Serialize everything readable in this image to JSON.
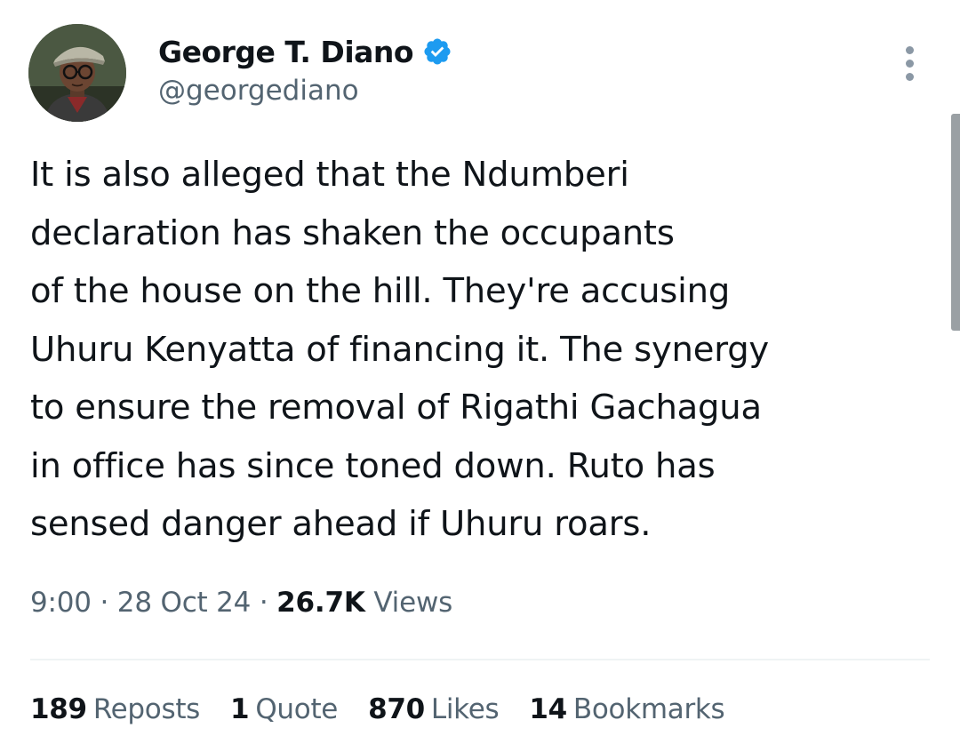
{
  "author": {
    "display_name": "George T. Diano",
    "handle": "@georgediano",
    "avatar_icon": "avatar-illustrated-cap-glasses",
    "verified": true,
    "verified_color": "#1d9bf0"
  },
  "tweet": {
    "lines": [
      "It is also alleged that the Ndumberi",
      "declaration has shaken the occupants",
      "of the house on the hill. They're accusing",
      "Uhuru Kenyatta of financing it. The synergy",
      "to ensure the removal of Rigathi Gachagua",
      "in office has since toned down. Ruto has",
      "sensed danger ahead if Uhuru roars."
    ]
  },
  "meta": {
    "time": "9:00",
    "separator": "·",
    "date": "28 Oct 24",
    "views_count": "26.7K",
    "views_label": "Views"
  },
  "stats": {
    "reposts": {
      "count": "189",
      "label": "Reposts"
    },
    "quotes": {
      "count": "1",
      "label": "Quote"
    },
    "likes": {
      "count": "870",
      "label": "Likes"
    },
    "bookmarks": {
      "count": "14",
      "label": "Bookmarks"
    }
  },
  "colors": {
    "text_primary": "#0f1419",
    "text_secondary": "#536471",
    "divider": "#eff3f4",
    "accent": "#1d9bf0"
  }
}
